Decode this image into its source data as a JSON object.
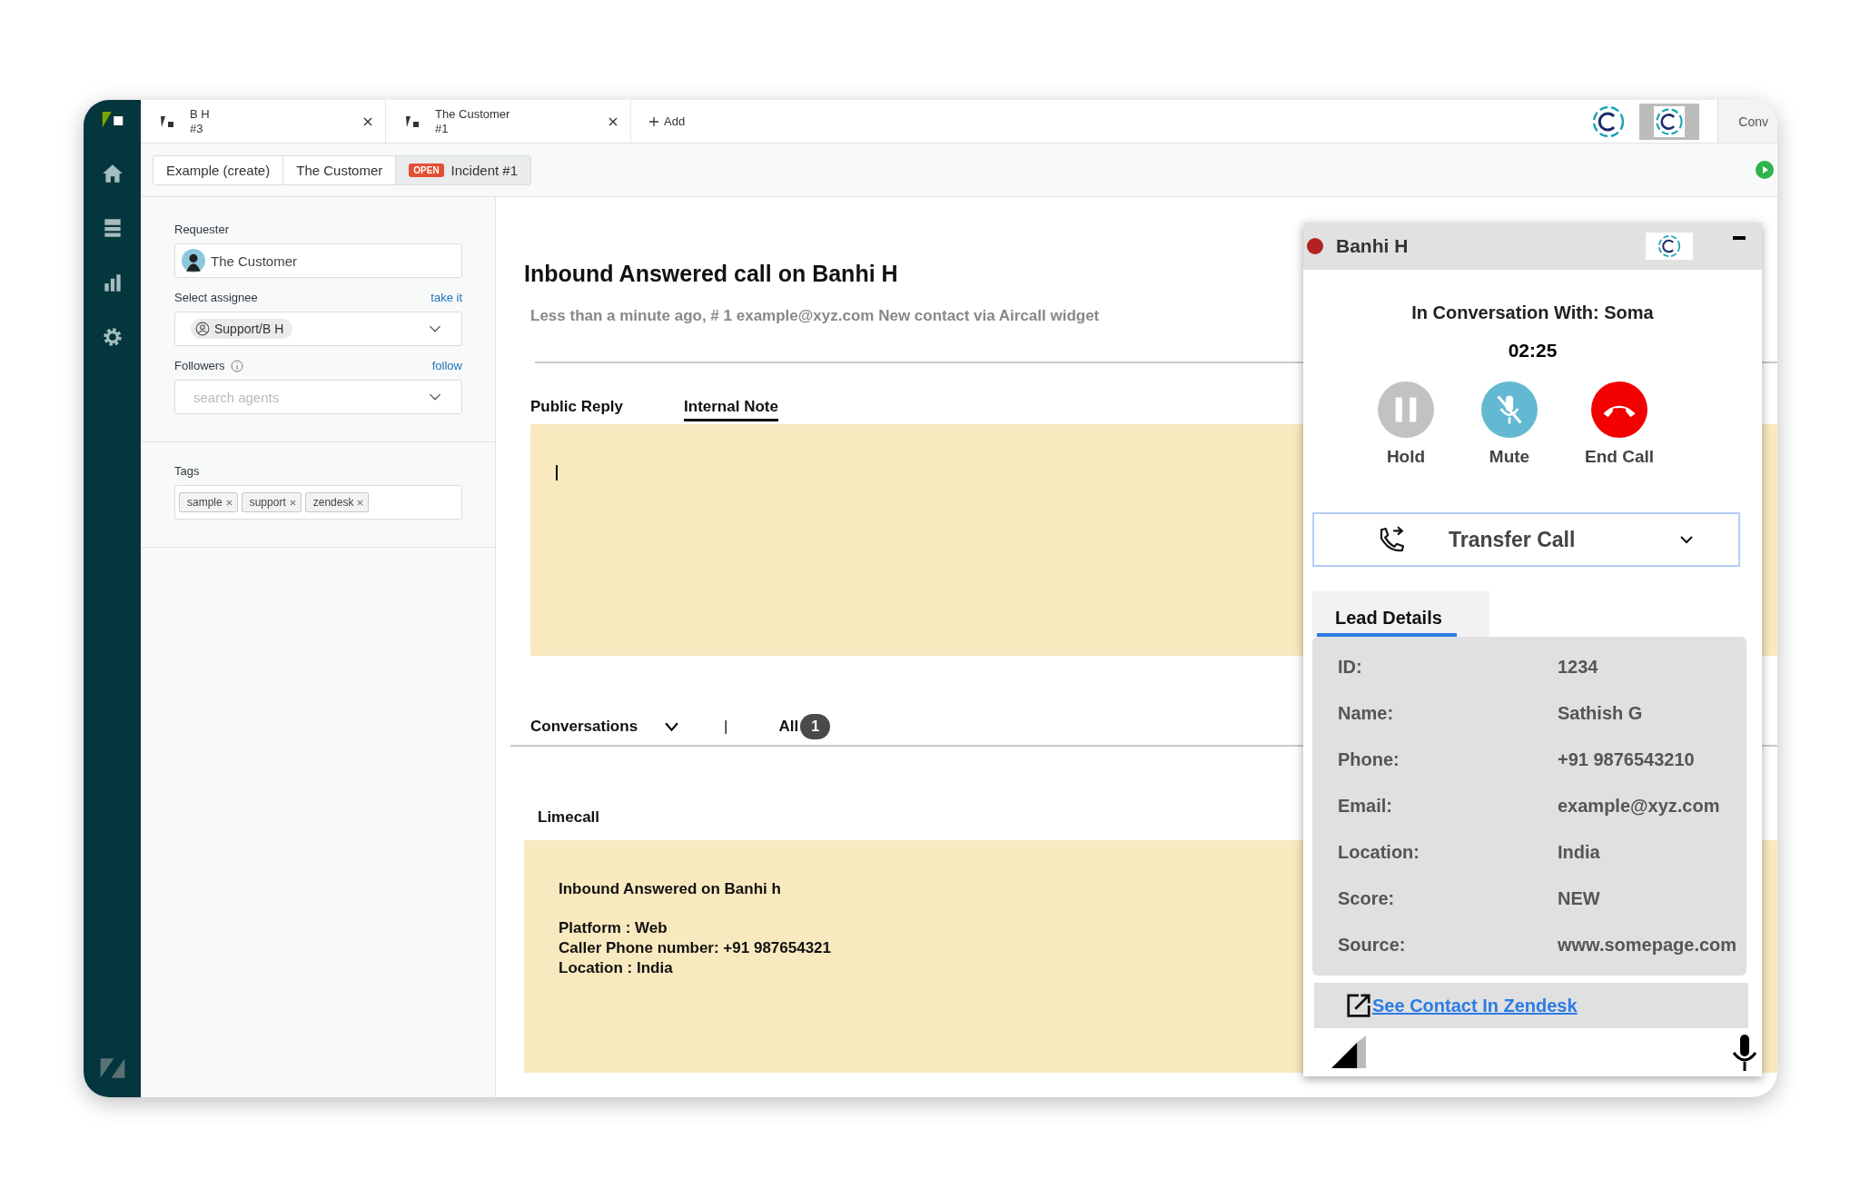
{
  "browser_tabs": [
    {
      "title": "B H",
      "subtitle": "#3"
    },
    {
      "title": "The Customer",
      "subtitle": "#1"
    }
  ],
  "add_tab": "Add",
  "right_tab": "Conv",
  "breadcrumbs": [
    {
      "label": "Example (create)"
    },
    {
      "label": "The Customer"
    },
    {
      "label": "Incident #1",
      "badge": "OPEN"
    }
  ],
  "sidebar": {
    "requester": {
      "label": "Requester",
      "value": "The Customer"
    },
    "assignee": {
      "label": "Select assignee",
      "action": "take it",
      "value": "Support/B H"
    },
    "followers": {
      "label": "Followers",
      "action": "follow",
      "placeholder": "search agents"
    },
    "tags": {
      "label": "Tags",
      "items": [
        "sample",
        "support",
        "zendesk"
      ]
    }
  },
  "ticket": {
    "title": "Inbound Answered call on Banhi H",
    "meta": "Less than a minute ago, # 1  example@xyz.com New contact via Aircall widget",
    "reply_tabs": [
      {
        "label": "Public Reply",
        "selected": false
      },
      {
        "label": "Internal Note",
        "selected": true
      }
    ],
    "conversations": {
      "label": "Conversations",
      "separator": "|",
      "filter": "All",
      "count": "1"
    },
    "event": {
      "source": "Limecall",
      "heading": "Inbound Answered on Banhi h",
      "lines": [
        "Platform : Web",
        "Caller Phone number: +91 987654321",
        "Location : India"
      ]
    }
  },
  "call_widget": {
    "agent": "Banhi H",
    "conversation": "In Conversation With: Soma",
    "timer": "02:25",
    "controls": [
      {
        "kind": "hold",
        "label": "Hold"
      },
      {
        "kind": "mute",
        "label": "Mute"
      },
      {
        "kind": "end",
        "label": "End Call"
      }
    ],
    "transfer": "Transfer Call",
    "tab": "Lead Details",
    "lead": [
      {
        "label": "ID:",
        "value": "1234"
      },
      {
        "label": "Name:",
        "value": "Sathish G"
      },
      {
        "label": "Phone:",
        "value": "+91 9876543210"
      },
      {
        "label": "Email:",
        "value": "example@xyz.com"
      },
      {
        "label": "Location:",
        "value": "India"
      },
      {
        "label": "Score:",
        "value": "NEW"
      },
      {
        "label": "Source:",
        "value": "www.somepage.com"
      }
    ],
    "link": "See Contact In Zendesk"
  }
}
